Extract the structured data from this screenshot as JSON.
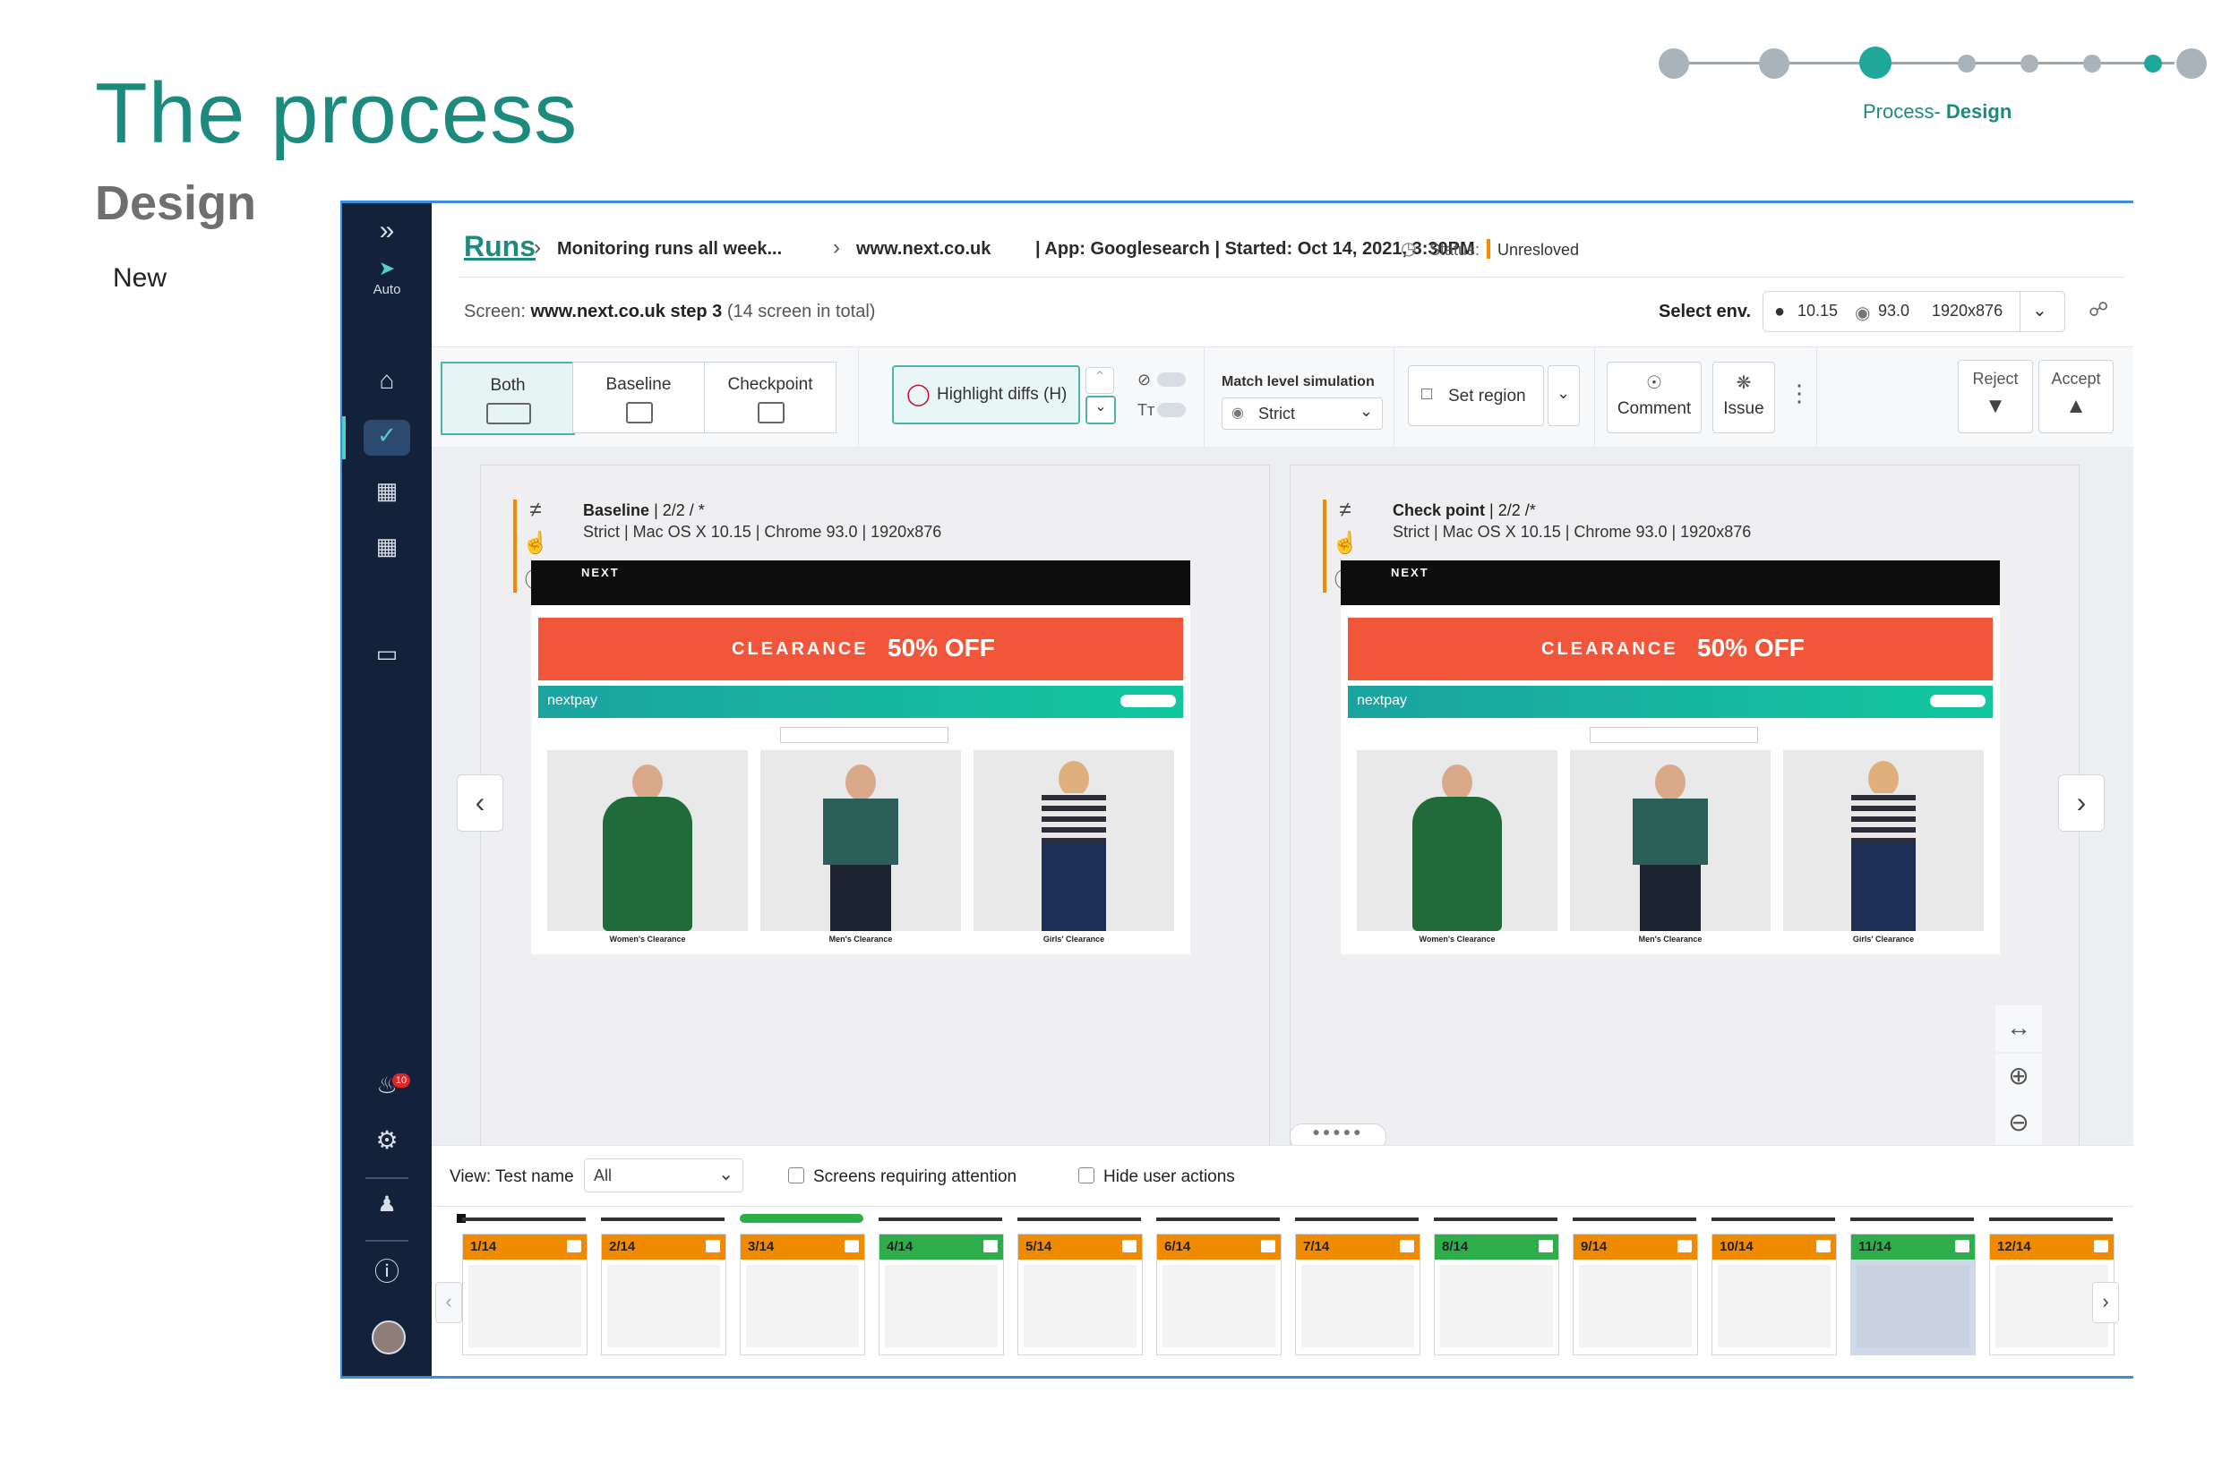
{
  "slide": {
    "title": "The process",
    "subtitle": "Design",
    "new_label": "New",
    "progress_label_prefix": "Process- ",
    "progress_label_bold": "Design"
  },
  "sidebar": {
    "expand_icon": "»",
    "auto_label": "Auto",
    "notification_count": "10"
  },
  "breadcrumb": {
    "runs": "Runs",
    "run_name": "Monitoring runs all week...",
    "site": "www.next.co.uk",
    "details": "| App: Googlesearch | Started: Oct 14, 2021, 3:30PM",
    "status_label": "Status:",
    "status_value": "Unresloved"
  },
  "screen_info": {
    "prefix": "Screen: ",
    "name": "www.next.co.uk step 3",
    "total": "(14 screen in total)"
  },
  "env": {
    "label": "Select env.",
    "os": "10.15",
    "browser": "93.0",
    "resolution": "1920x876"
  },
  "toolbar": {
    "view_both": "Both",
    "view_baseline": "Baseline",
    "view_checkpoint": "Checkpoint",
    "highlight": "Highlight diffs (H)",
    "match_level_label": "Match level simulation",
    "match_level_value": "Strict",
    "set_region": "Set region",
    "comment": "Comment",
    "issue": "Issue",
    "reject": "Reject",
    "accept": "Accept"
  },
  "panels": [
    {
      "title": "Baseline",
      "count": "| 2/2 / *",
      "meta": "Strict | Mac OS X 10.15 | Chrome 93.0 | 1920x876"
    },
    {
      "title": "Check point",
      "count": "| 2/2 /*",
      "meta": "Strict | Mac OS X 10.15 | Chrome 93.0 | 1920x876"
    }
  ],
  "site_preview": {
    "logo": "NEXT",
    "banner_word": "CLEARANCE",
    "banner_offer": "50% OFF",
    "pay": "nextpay",
    "products": [
      "Women's Clearance",
      "Men's Clearance",
      "Girls' Clearance"
    ]
  },
  "filter": {
    "view_label": "View: Test name",
    "view_value": "All",
    "attention": "Screens requiring attention",
    "hide_actions": "Hide user actions"
  },
  "thumbnails": [
    {
      "label": "1/14",
      "status": "#f08a00"
    },
    {
      "label": "2/14",
      "status": "#f08a00"
    },
    {
      "label": "3/14",
      "status": "#f08a00"
    },
    {
      "label": "4/14",
      "status": "#2eae4a"
    },
    {
      "label": "5/14",
      "status": "#f08a00"
    },
    {
      "label": "6/14",
      "status": "#f08a00"
    },
    {
      "label": "7/14",
      "status": "#f08a00"
    },
    {
      "label": "8/14",
      "status": "#2eae4a"
    },
    {
      "label": "9/14",
      "status": "#f08a00"
    },
    {
      "label": "10/14",
      "status": "#f08a00"
    },
    {
      "label": "11/14",
      "status": "#2eae4a"
    },
    {
      "label": "12/14",
      "status": "#f08a00"
    }
  ],
  "colors": {
    "brand_teal": "#1d8a7e",
    "unresolved": "#f08a00",
    "passed": "#2eae4a",
    "sidebar_bg": "#13213a"
  }
}
